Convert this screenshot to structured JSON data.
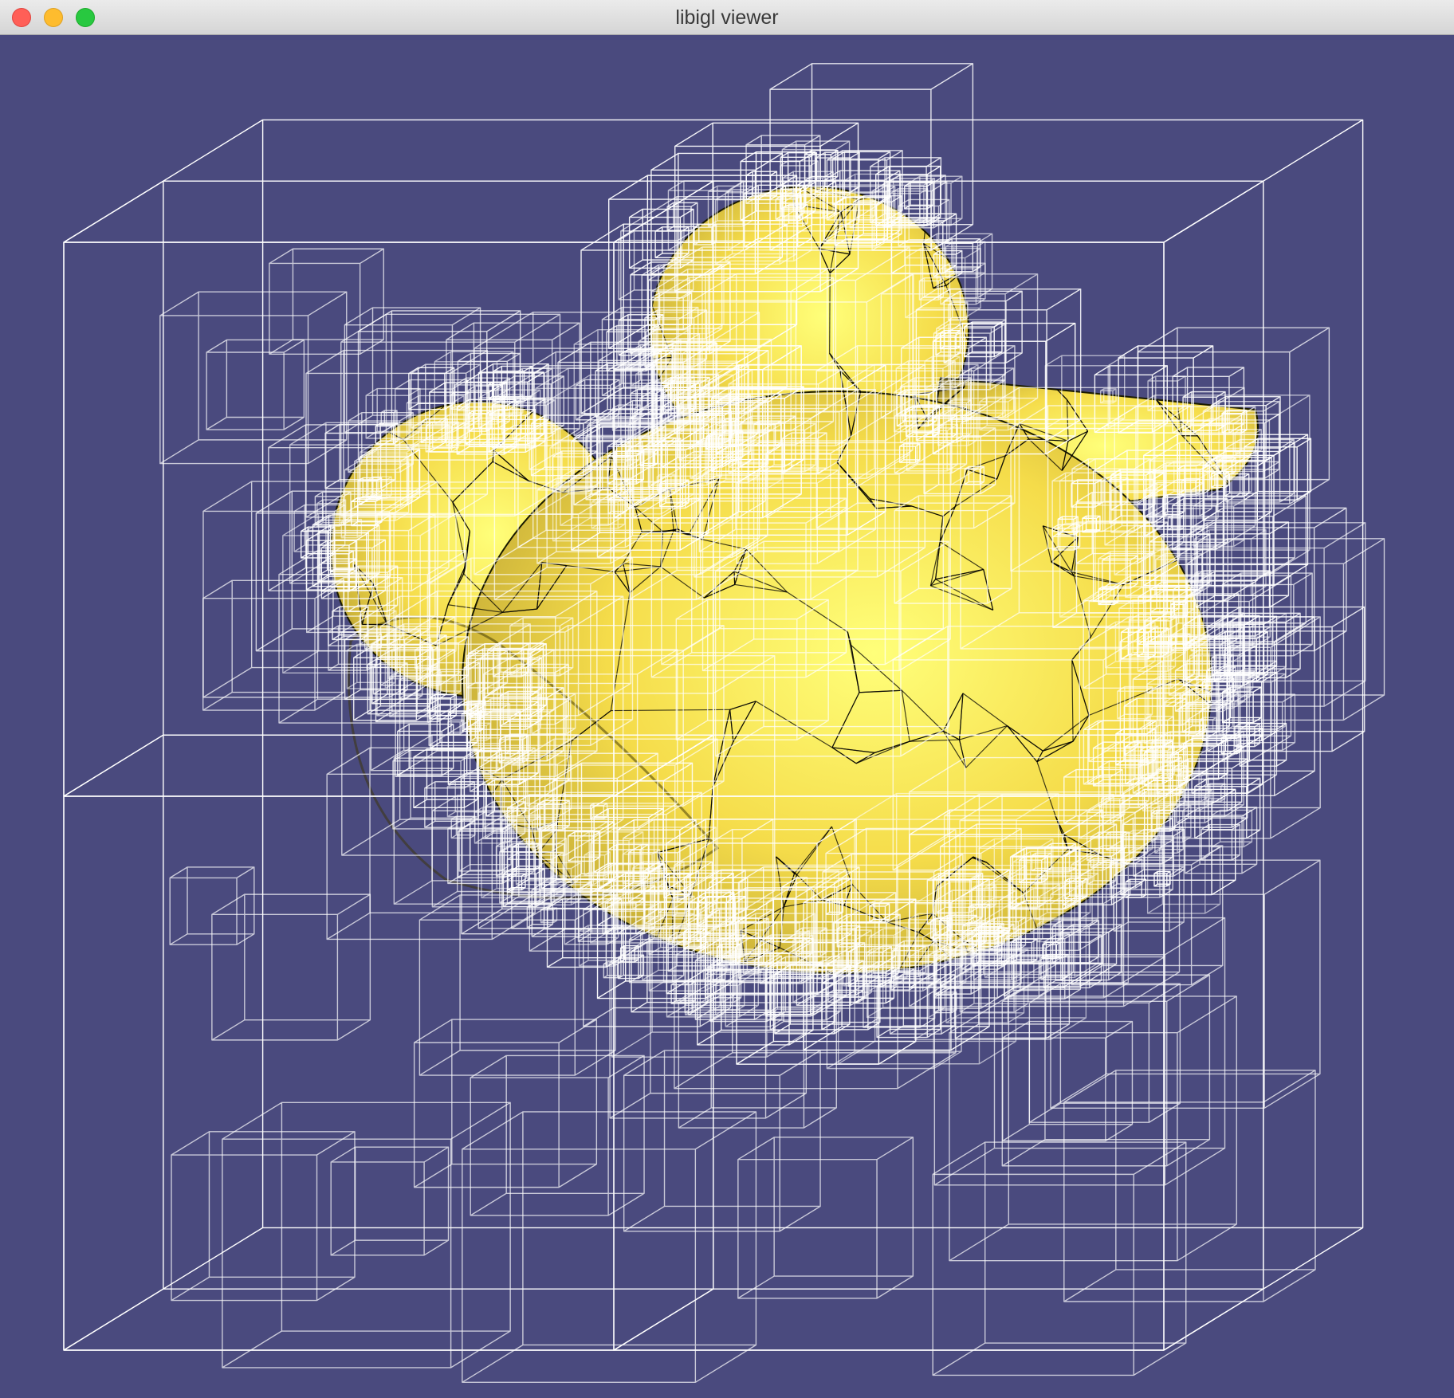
{
  "window": {
    "title": "libigl viewer",
    "controls": [
      "close",
      "minimize",
      "zoom"
    ]
  },
  "viewport": {
    "background_color": "#4a4a7e",
    "mesh_color": "#f5dc4a",
    "mesh_edge_color": "#000000",
    "wireframe_color": "#ffffff",
    "content": "octree-wireframe-over-rubber-duck-mesh"
  }
}
